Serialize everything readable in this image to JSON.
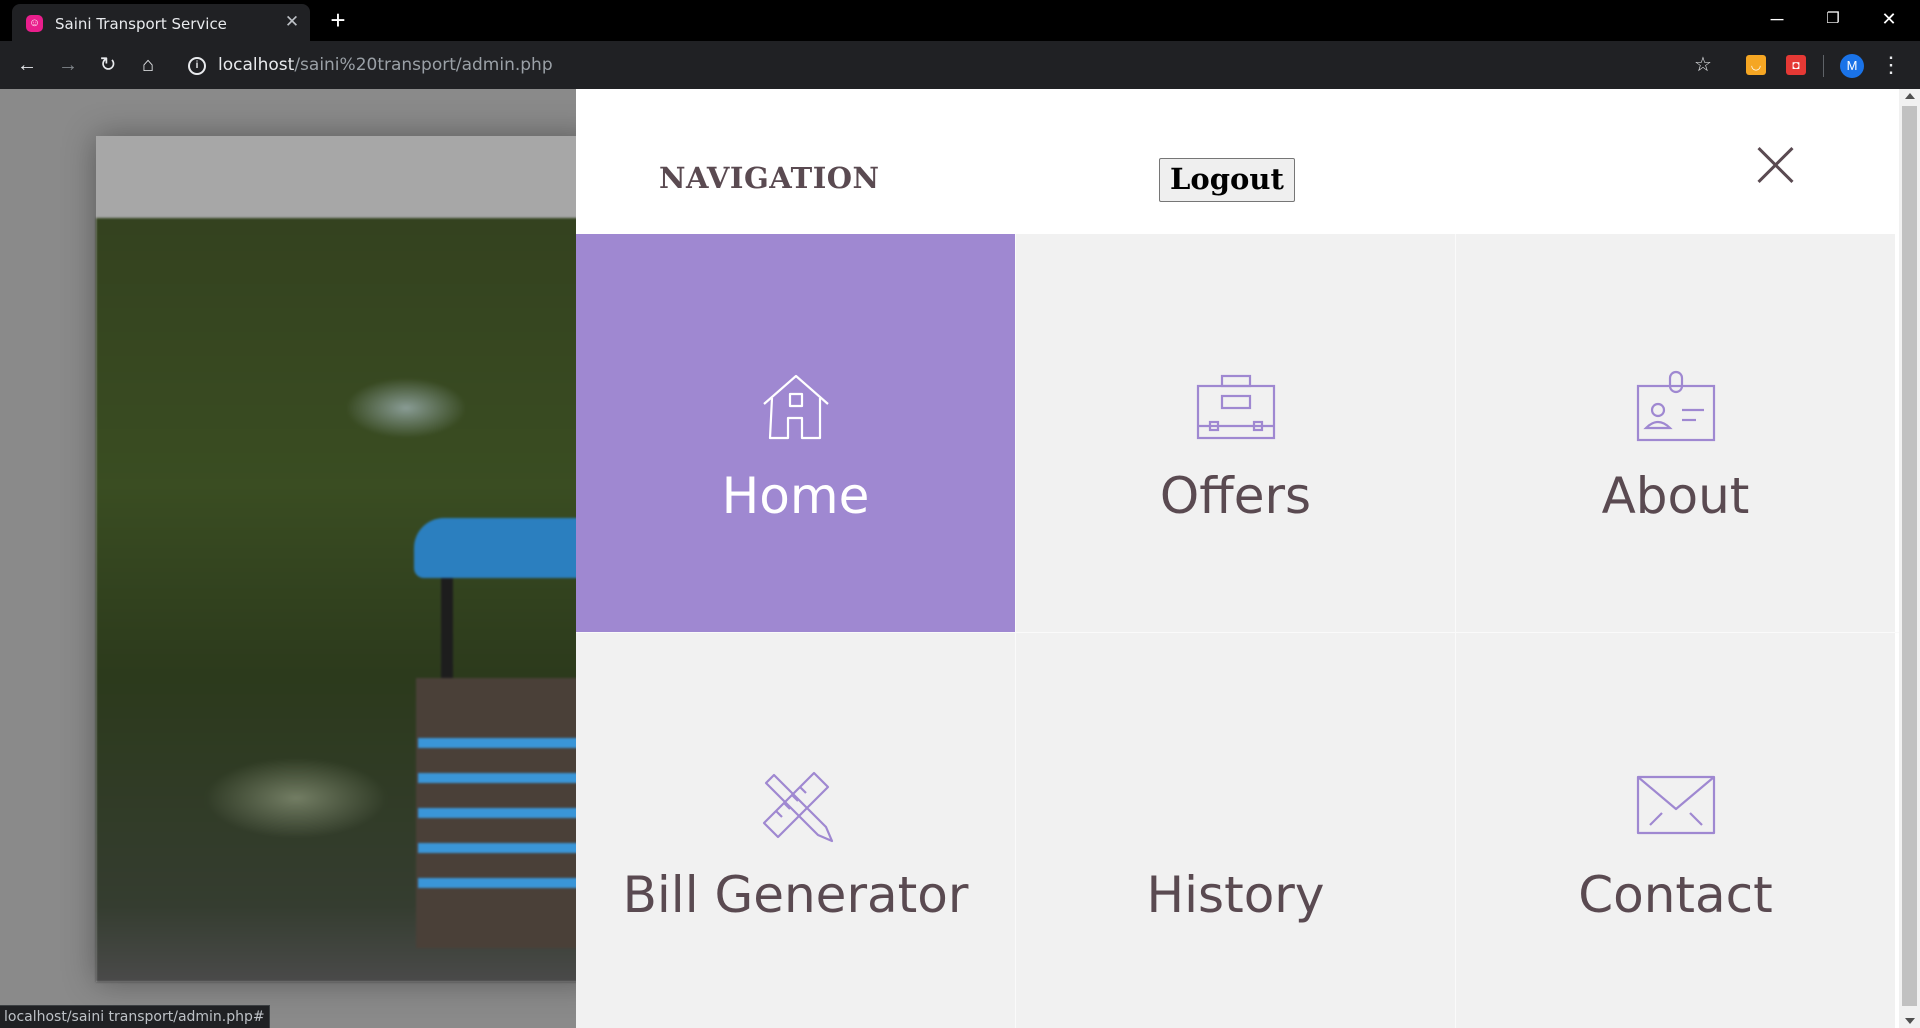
{
  "browser": {
    "tab_title": "Saini Transport Service",
    "tab_favicon_glyph": "☺",
    "url_host": "localhost",
    "url_path": "/saini%20transport/admin.php",
    "status_url": "localhost/saini transport/admin.php#",
    "profile_initial": "M"
  },
  "menu": {
    "title": "NAVIGATION",
    "logout_label": "Logout",
    "accent_color": "#9f88d1",
    "tiles": [
      {
        "label": "Home",
        "icon": "house-icon",
        "active": true
      },
      {
        "label": "Offers",
        "icon": "briefcase-icon",
        "active": false
      },
      {
        "label": "About",
        "icon": "id-badge-icon",
        "active": false
      },
      {
        "label": "Bill Generator",
        "icon": "ruler-pencil-icon",
        "active": false
      },
      {
        "label": "History",
        "icon": "",
        "active": false
      },
      {
        "label": "Contact",
        "icon": "envelope-icon",
        "active": false
      }
    ]
  }
}
